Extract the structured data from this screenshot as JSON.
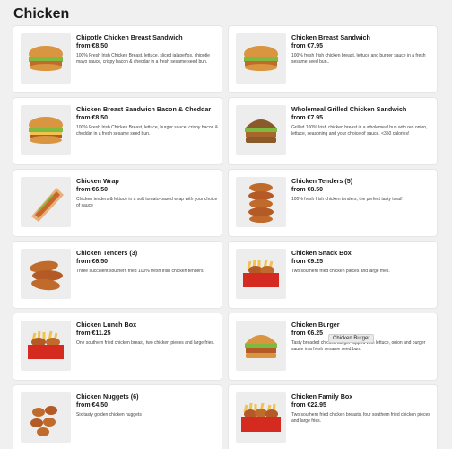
{
  "page": {
    "heading": "Chicken"
  },
  "tooltip": "Chicken Burger",
  "items": [
    {
      "name": "Chipotle Chicken Breast Sandwich",
      "price": "from €8.50",
      "desc": "100% Fresh Irish Chicken Breast, lettuce, sliced jalapeños, chipotle mayo sauce, crispy bacon & cheddar in a fresh sesame seed bun.",
      "icon": "sandwich-icon"
    },
    {
      "name": "Chicken Breast Sandwich",
      "price": "from €7.95",
      "desc": "100% fresh Irish chicken breast, lettuce and burger sauce in a fresh sesame seed bun..",
      "icon": "sandwich-icon"
    },
    {
      "name": "Chicken Breast Sandwich Bacon & Cheddar",
      "price": "from €8.50",
      "desc": "100% Fresh Irish Chicken Breast, lettuce, burger sauce, crispy bacon & cheddar in a fresh sesame seed bun.",
      "icon": "sandwich-icon"
    },
    {
      "name": "Wholemeal Grilled Chicken Sandwich",
      "price": "from €7.95",
      "desc": "Grilled 100% Irish chicken breast in a wholemeal bun with red onion, lettuce, seasoning and your choice of sauce. <350 calories!",
      "icon": "burger-icon"
    },
    {
      "name": "Chicken Wrap",
      "price": "from €6.50",
      "desc": "Chicken tenders & lettuce in a soft tomato-based wrap with your choice of sauce",
      "icon": "wrap-icon"
    },
    {
      "name": "Chicken Tenders (5)",
      "price": "from €8.50",
      "desc": "100% fresh Irish chicken tenders, the perfect tasty treat!",
      "icon": "tenders-stack-icon"
    },
    {
      "name": "Chicken Tenders (3)",
      "price": "from €6.50",
      "desc": "Three succulent southern fried 100% fresh Irish chicken tenders.",
      "icon": "tenders-icon"
    },
    {
      "name": "Chicken Snack Box",
      "price": "from €9.25",
      "desc": "Two southern fried chicken pieces and large fries.",
      "icon": "box-icon"
    },
    {
      "name": "Chicken Lunch Box",
      "price": "from €11.25",
      "desc": "One southern fried chicken breast, two chicken pieces and large fries.",
      "icon": "box-icon"
    },
    {
      "name": "Chicken Burger",
      "price": "from €6.25",
      "desc": "Tasty breaded chicken burger topped with lettuce, onion and burger sauce in a fresh sesame seed bun.",
      "icon": "burger-icon"
    },
    {
      "name": "Chicken Nuggets (6)",
      "price": "from €4.50",
      "desc": "Six tasty golden chicken nuggets",
      "icon": "nuggets-icon"
    },
    {
      "name": "Chicken Family Box",
      "price": "from €22.95",
      "desc": "Two southern fried chicken breasts, four southern fried chicken pieces and large fries.",
      "icon": "family-box-icon"
    }
  ]
}
